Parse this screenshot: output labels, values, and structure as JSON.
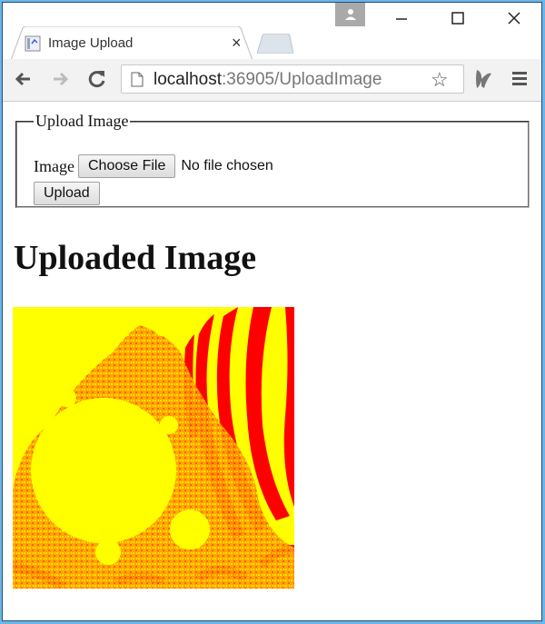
{
  "browser": {
    "tab": {
      "title": "Image Upload",
      "favicon": "page-chart-icon",
      "close": "×"
    },
    "window_controls": {
      "minimize": "—",
      "maximize": "☐",
      "close": "✕"
    },
    "nav": {
      "back": "back-arrow-icon",
      "forward": "forward-arrow-icon",
      "reload": "reload-icon"
    },
    "address": {
      "host": "localhost",
      "rest": ":36905/UploadImage"
    },
    "star": "☆"
  },
  "form": {
    "legend": "Upload Image",
    "image_label": "Image",
    "choose_file_label": "Choose File",
    "no_file_text": "No file chosen",
    "upload_label": "Upload"
  },
  "result": {
    "heading": "Uploaded Image",
    "image_description": "Mandelbrot fractal in yellow and red",
    "colors": {
      "primary": "#ffff00",
      "secondary": "#ff0000",
      "mid": "#ff9900"
    }
  }
}
